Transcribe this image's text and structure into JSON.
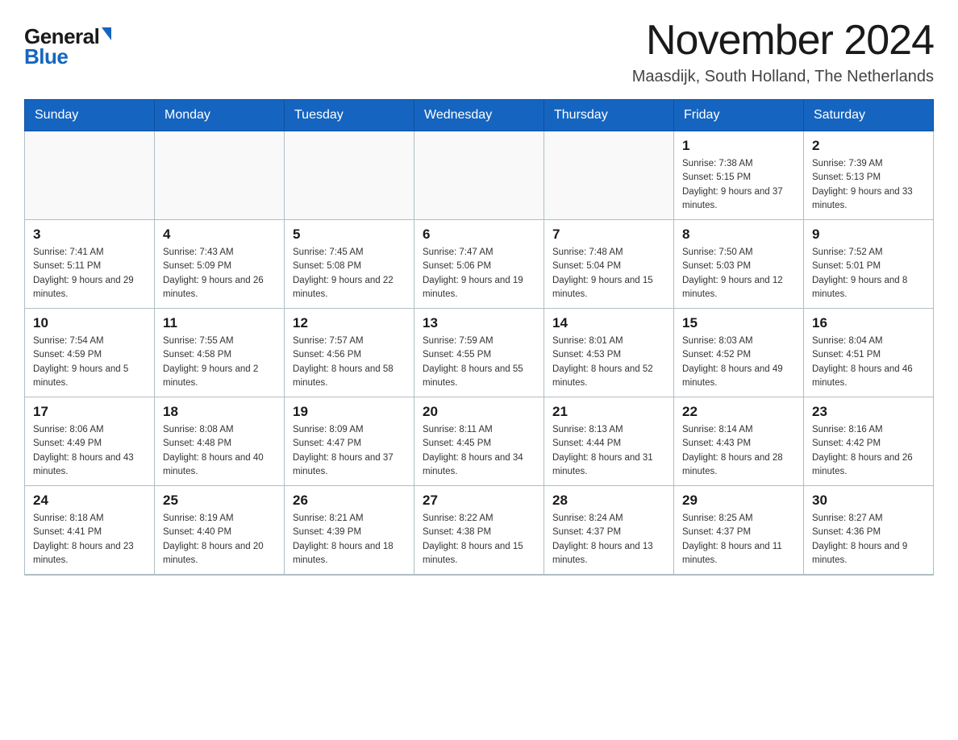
{
  "logo": {
    "general": "General",
    "blue": "Blue"
  },
  "header": {
    "title": "November 2024",
    "subtitle": "Maasdijk, South Holland, The Netherlands"
  },
  "days_of_week": [
    "Sunday",
    "Monday",
    "Tuesday",
    "Wednesday",
    "Thursday",
    "Friday",
    "Saturday"
  ],
  "weeks": [
    [
      {
        "day": "",
        "info": ""
      },
      {
        "day": "",
        "info": ""
      },
      {
        "day": "",
        "info": ""
      },
      {
        "day": "",
        "info": ""
      },
      {
        "day": "",
        "info": ""
      },
      {
        "day": "1",
        "info": "Sunrise: 7:38 AM\nSunset: 5:15 PM\nDaylight: 9 hours and 37 minutes."
      },
      {
        "day": "2",
        "info": "Sunrise: 7:39 AM\nSunset: 5:13 PM\nDaylight: 9 hours and 33 minutes."
      }
    ],
    [
      {
        "day": "3",
        "info": "Sunrise: 7:41 AM\nSunset: 5:11 PM\nDaylight: 9 hours and 29 minutes."
      },
      {
        "day": "4",
        "info": "Sunrise: 7:43 AM\nSunset: 5:09 PM\nDaylight: 9 hours and 26 minutes."
      },
      {
        "day": "5",
        "info": "Sunrise: 7:45 AM\nSunset: 5:08 PM\nDaylight: 9 hours and 22 minutes."
      },
      {
        "day": "6",
        "info": "Sunrise: 7:47 AM\nSunset: 5:06 PM\nDaylight: 9 hours and 19 minutes."
      },
      {
        "day": "7",
        "info": "Sunrise: 7:48 AM\nSunset: 5:04 PM\nDaylight: 9 hours and 15 minutes."
      },
      {
        "day": "8",
        "info": "Sunrise: 7:50 AM\nSunset: 5:03 PM\nDaylight: 9 hours and 12 minutes."
      },
      {
        "day": "9",
        "info": "Sunrise: 7:52 AM\nSunset: 5:01 PM\nDaylight: 9 hours and 8 minutes."
      }
    ],
    [
      {
        "day": "10",
        "info": "Sunrise: 7:54 AM\nSunset: 4:59 PM\nDaylight: 9 hours and 5 minutes."
      },
      {
        "day": "11",
        "info": "Sunrise: 7:55 AM\nSunset: 4:58 PM\nDaylight: 9 hours and 2 minutes."
      },
      {
        "day": "12",
        "info": "Sunrise: 7:57 AM\nSunset: 4:56 PM\nDaylight: 8 hours and 58 minutes."
      },
      {
        "day": "13",
        "info": "Sunrise: 7:59 AM\nSunset: 4:55 PM\nDaylight: 8 hours and 55 minutes."
      },
      {
        "day": "14",
        "info": "Sunrise: 8:01 AM\nSunset: 4:53 PM\nDaylight: 8 hours and 52 minutes."
      },
      {
        "day": "15",
        "info": "Sunrise: 8:03 AM\nSunset: 4:52 PM\nDaylight: 8 hours and 49 minutes."
      },
      {
        "day": "16",
        "info": "Sunrise: 8:04 AM\nSunset: 4:51 PM\nDaylight: 8 hours and 46 minutes."
      }
    ],
    [
      {
        "day": "17",
        "info": "Sunrise: 8:06 AM\nSunset: 4:49 PM\nDaylight: 8 hours and 43 minutes."
      },
      {
        "day": "18",
        "info": "Sunrise: 8:08 AM\nSunset: 4:48 PM\nDaylight: 8 hours and 40 minutes."
      },
      {
        "day": "19",
        "info": "Sunrise: 8:09 AM\nSunset: 4:47 PM\nDaylight: 8 hours and 37 minutes."
      },
      {
        "day": "20",
        "info": "Sunrise: 8:11 AM\nSunset: 4:45 PM\nDaylight: 8 hours and 34 minutes."
      },
      {
        "day": "21",
        "info": "Sunrise: 8:13 AM\nSunset: 4:44 PM\nDaylight: 8 hours and 31 minutes."
      },
      {
        "day": "22",
        "info": "Sunrise: 8:14 AM\nSunset: 4:43 PM\nDaylight: 8 hours and 28 minutes."
      },
      {
        "day": "23",
        "info": "Sunrise: 8:16 AM\nSunset: 4:42 PM\nDaylight: 8 hours and 26 minutes."
      }
    ],
    [
      {
        "day": "24",
        "info": "Sunrise: 8:18 AM\nSunset: 4:41 PM\nDaylight: 8 hours and 23 minutes."
      },
      {
        "day": "25",
        "info": "Sunrise: 8:19 AM\nSunset: 4:40 PM\nDaylight: 8 hours and 20 minutes."
      },
      {
        "day": "26",
        "info": "Sunrise: 8:21 AM\nSunset: 4:39 PM\nDaylight: 8 hours and 18 minutes."
      },
      {
        "day": "27",
        "info": "Sunrise: 8:22 AM\nSunset: 4:38 PM\nDaylight: 8 hours and 15 minutes."
      },
      {
        "day": "28",
        "info": "Sunrise: 8:24 AM\nSunset: 4:37 PM\nDaylight: 8 hours and 13 minutes."
      },
      {
        "day": "29",
        "info": "Sunrise: 8:25 AM\nSunset: 4:37 PM\nDaylight: 8 hours and 11 minutes."
      },
      {
        "day": "30",
        "info": "Sunrise: 8:27 AM\nSunset: 4:36 PM\nDaylight: 8 hours and 9 minutes."
      }
    ]
  ]
}
